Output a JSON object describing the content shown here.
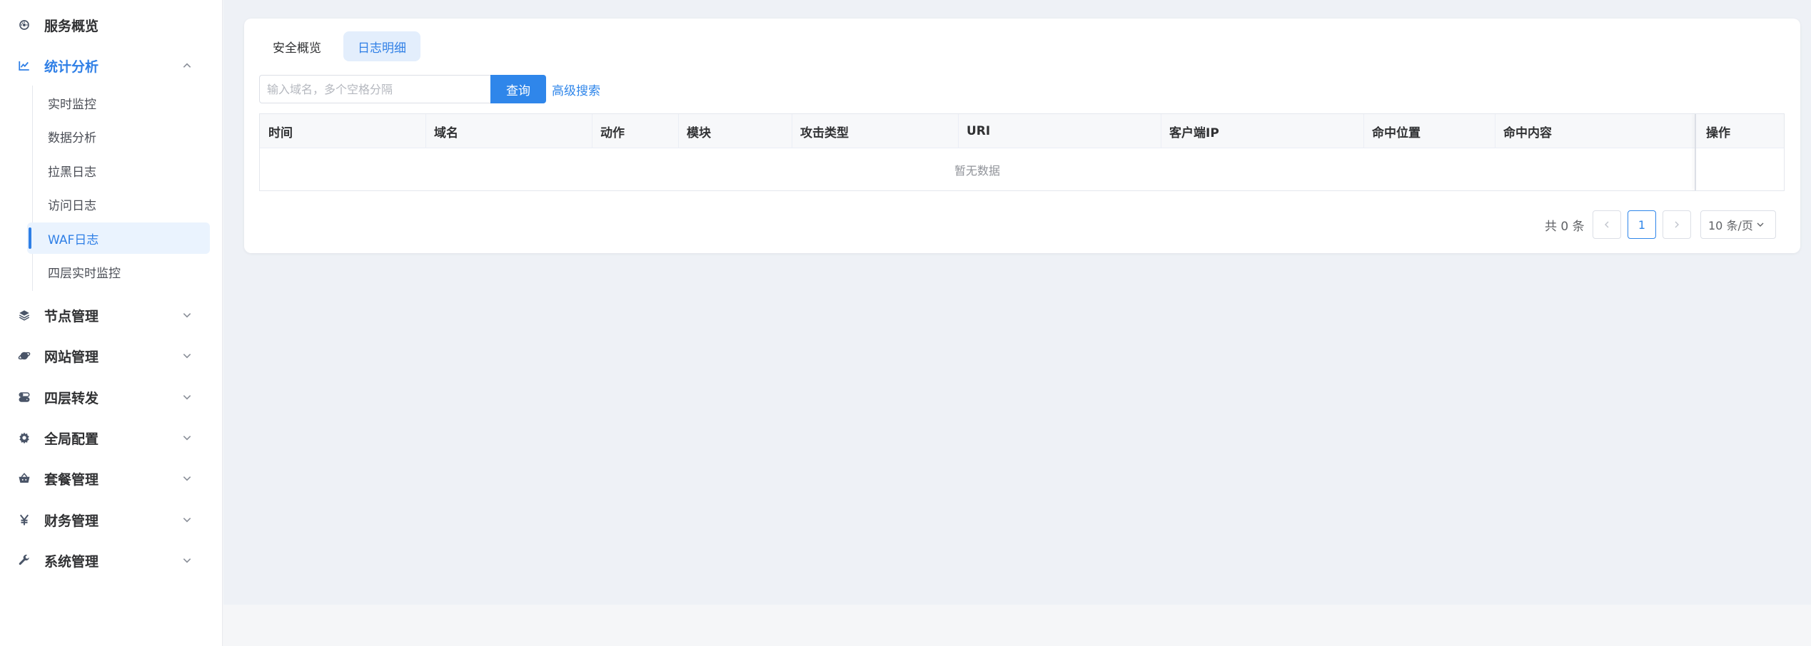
{
  "sidebar": {
    "items": [
      {
        "label": "服务概览",
        "icon": "dashboard-icon"
      },
      {
        "label": "统计分析",
        "icon": "chart-icon",
        "expanded": true
      },
      {
        "label": "节点管理",
        "icon": "layers-icon"
      },
      {
        "label": "网站管理",
        "icon": "planet-icon"
      },
      {
        "label": "四层转发",
        "icon": "switch-icon"
      },
      {
        "label": "全局配置",
        "icon": "gear-icon"
      },
      {
        "label": "套餐管理",
        "icon": "basket-icon"
      },
      {
        "label": "财务管理",
        "icon": "yen-icon"
      },
      {
        "label": "系统管理",
        "icon": "wrench-icon"
      }
    ],
    "sub_items": [
      {
        "label": "实时监控"
      },
      {
        "label": "数据分析"
      },
      {
        "label": "拉黑日志"
      },
      {
        "label": "访问日志"
      },
      {
        "label": "WAF日志",
        "current": true
      },
      {
        "label": "四层实时监控"
      }
    ]
  },
  "tabs": [
    {
      "label": "安全概览"
    },
    {
      "label": "日志明细",
      "active": true
    }
  ],
  "search": {
    "placeholder": "输入域名，多个空格分隔",
    "query_label": "查询",
    "advanced_label": "高级搜索"
  },
  "table": {
    "columns": [
      "时间",
      "域名",
      "动作",
      "模块",
      "攻击类型",
      "URI",
      "客户端IP",
      "命中位置",
      "命中内容",
      "操作"
    ],
    "empty_text": "暂无数据"
  },
  "pagination": {
    "total_label": "共 0 条",
    "current_page": "1",
    "page_size_label": "10 条/页"
  },
  "colors": {
    "accent": "#2f86ea",
    "active_bg": "#eaf3fe",
    "page_bg": "#eef1f6"
  }
}
